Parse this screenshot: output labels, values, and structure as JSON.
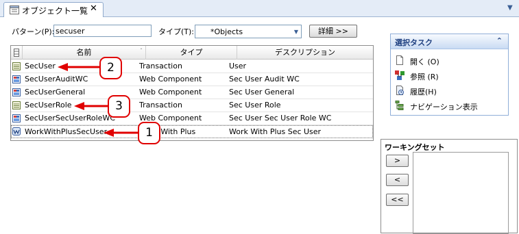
{
  "tab": {
    "title": "オブジェクト一覧",
    "close": "✕",
    "icon": "object-list-icon"
  },
  "filter": {
    "pattern_label": "パターン(P):",
    "pattern_value": "secuser",
    "type_label": "タイプ(T):",
    "type_value": "*Objects",
    "details_button": "詳細 >>"
  },
  "grid": {
    "columns": [
      "名前",
      "タイプ",
      "デスクリプション"
    ],
    "rows": [
      {
        "name": "SecUser",
        "type": "Transaction",
        "description": "User",
        "icon": "transaction-icon"
      },
      {
        "name": "SecUserAuditWC",
        "type": "Web Component",
        "description": "Sec User Audit WC",
        "icon": "web-component-icon"
      },
      {
        "name": "SecUserGeneral",
        "type": "Web Component",
        "description": "Sec User General",
        "icon": "web-component-icon"
      },
      {
        "name": "SecUserRole",
        "type": "Transaction",
        "description": "Sec User Role",
        "icon": "transaction-icon"
      },
      {
        "name": "SecUserSecUserRoleWC",
        "type": "Web Component",
        "description": "Sec User Sec User Role WC",
        "icon": "web-component-icon"
      },
      {
        "name": "WorkWithPlusSecUser",
        "type": "Work With Plus",
        "description": "Work With Plus Sec User",
        "icon": "work-with-plus-icon"
      }
    ]
  },
  "callouts": [
    "1",
    "2",
    "3"
  ],
  "task_pane": {
    "title": "選択タスク",
    "collapse": "«",
    "items": [
      {
        "label": "開く (O)",
        "icon": "open-icon"
      },
      {
        "label": "参照 (R)",
        "icon": "references-icon"
      },
      {
        "label": "履歴(H)",
        "icon": "history-icon"
      },
      {
        "label": "ナビゲーション表示",
        "icon": "navigation-icon"
      }
    ]
  },
  "working_set": {
    "title": "ワーキングセット",
    "buttons": [
      ">",
      "<",
      "<<"
    ]
  }
}
